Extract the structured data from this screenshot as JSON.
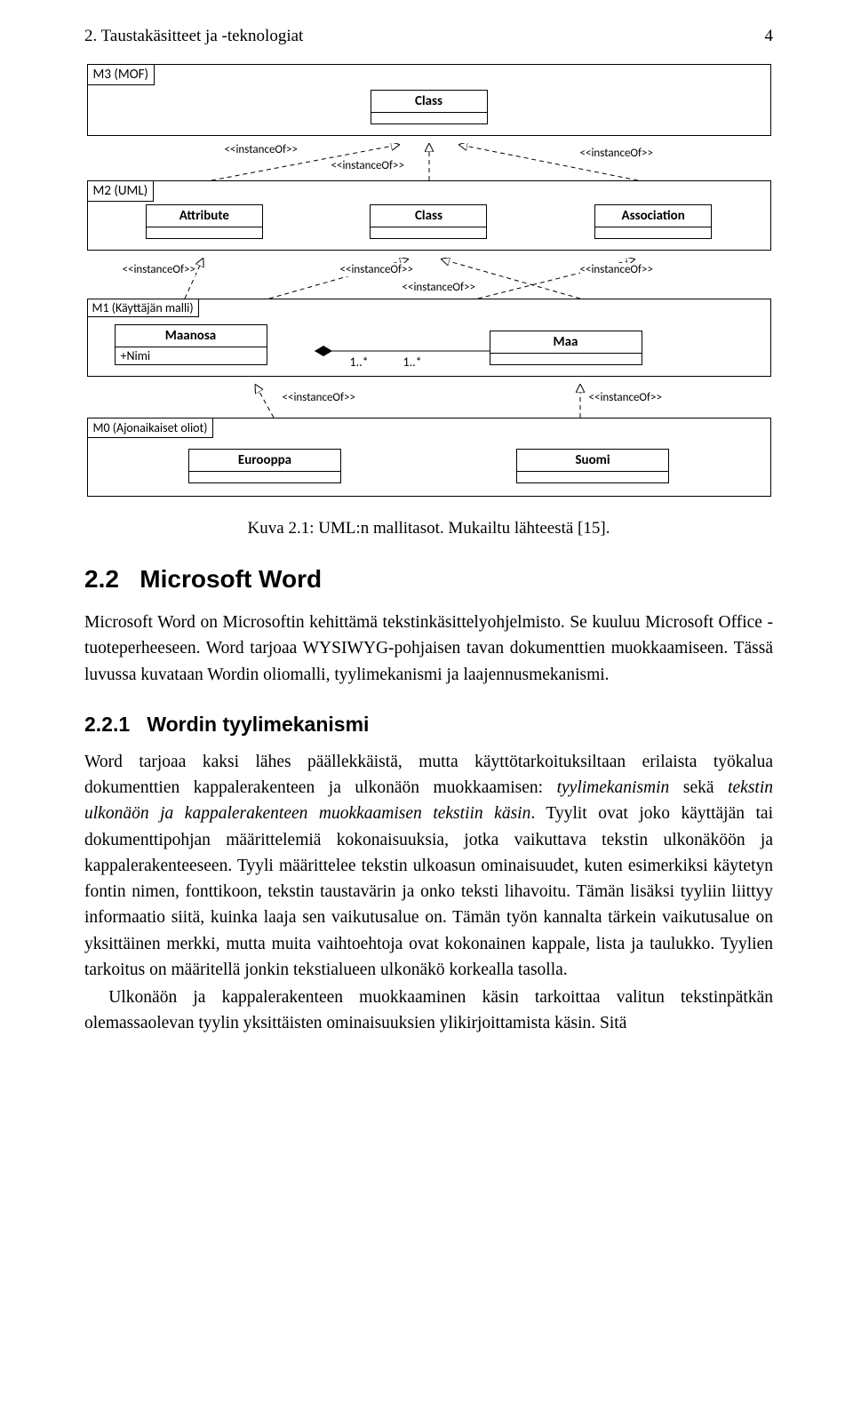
{
  "header": {
    "title": "2. Taustakäsitteet ja -teknologiat",
    "page": "4"
  },
  "diagram": {
    "m3": {
      "tab": "M3 (MOF)",
      "class": "Class"
    },
    "arrows12": {
      "l": "<<instanceOf>>",
      "c": "<<instanceOf>>",
      "r": "<<instanceOf>>"
    },
    "m2": {
      "tab": "M2 (UML)",
      "a": "Attribute",
      "b": "Class",
      "c": "Association"
    },
    "arrows23": {
      "l": "<<instanceOf>>",
      "c": "<<instanceOf>>",
      "cc": "<<instanceOf>>",
      "r": "<<instanceOf>>"
    },
    "m1": {
      "tab": "M1 (Käyttäjän malli)",
      "left": {
        "name": "Maanosa",
        "attr": "+Nimi"
      },
      "right": {
        "name": "Maa"
      },
      "mult1": "1..*",
      "mult2": "1..*"
    },
    "arrows34": {
      "l": "<<instanceOf>>",
      "r": "<<instanceOf>>"
    },
    "m0": {
      "tab": "M0 (Ajonaikaiset oliot)",
      "a": "Eurooppa",
      "b": "Suomi"
    }
  },
  "caption": "Kuva 2.1: UML:n mallitasot. Mukailtu lähteestä [15].",
  "sec": {
    "num": "2.2",
    "title": "Microsoft Word"
  },
  "para1": "Microsoft Word on Microsoftin kehittämä tekstinkäsittelyohjelmisto. Se kuuluu Microsoft Office -tuoteperheeseen. Word tarjoaa WYSIWYG-pohjaisen tavan dokumenttien muokkaamiseen. Tässä luvussa kuvataan Wordin oliomalli, tyylimekanismi ja laajennusmekanismi.",
  "subsec": {
    "num": "2.2.1",
    "title": "Wordin tyylimekanismi"
  },
  "para2": {
    "t1": "Word tarjoaa kaksi lähes päällekkäistä, mutta käyttötarkoituksiltaan erilaista työkalua dokumenttien kappalerakenteen ja ulkonäön muokkaamisen: ",
    "i1": "tyylimekanismin",
    "t2": " sekä ",
    "i2": "tekstin ulkonäön ja kappalerakenteen muokkaamisen tekstiin käsin",
    "t3": ". Tyylit ovat joko käyttäjän tai dokumenttipohjan määrittelemiä kokonaisuuksia, jotka vaikuttava tekstin ulkonäköön ja kappalerakenteeseen. Tyyli määrittelee tekstin ulkoasun ominaisuudet, kuten esimerkiksi käytetyn fontin nimen, fonttikoon, tekstin taustavärin ja onko teksti lihavoitu. Tämän lisäksi tyyliin liittyy informaatio siitä, kuinka laaja sen vaikutusalue on. Tämän työn kannalta tärkein vaikutusalue on yksittäinen merkki, mutta muita vaihtoehtoja ovat kokonainen kappale, lista ja taulukko. Tyylien tarkoitus on määritellä jonkin tekstialueen ulkonäkö korkealla tasolla."
  },
  "para3": "Ulkonäön ja kappalerakenteen muokkaaminen käsin tarkoittaa valitun tekstinpätkän olemassaolevan tyylin yksittäisten ominaisuuksien ylikirjoittamista käsin. Sitä"
}
